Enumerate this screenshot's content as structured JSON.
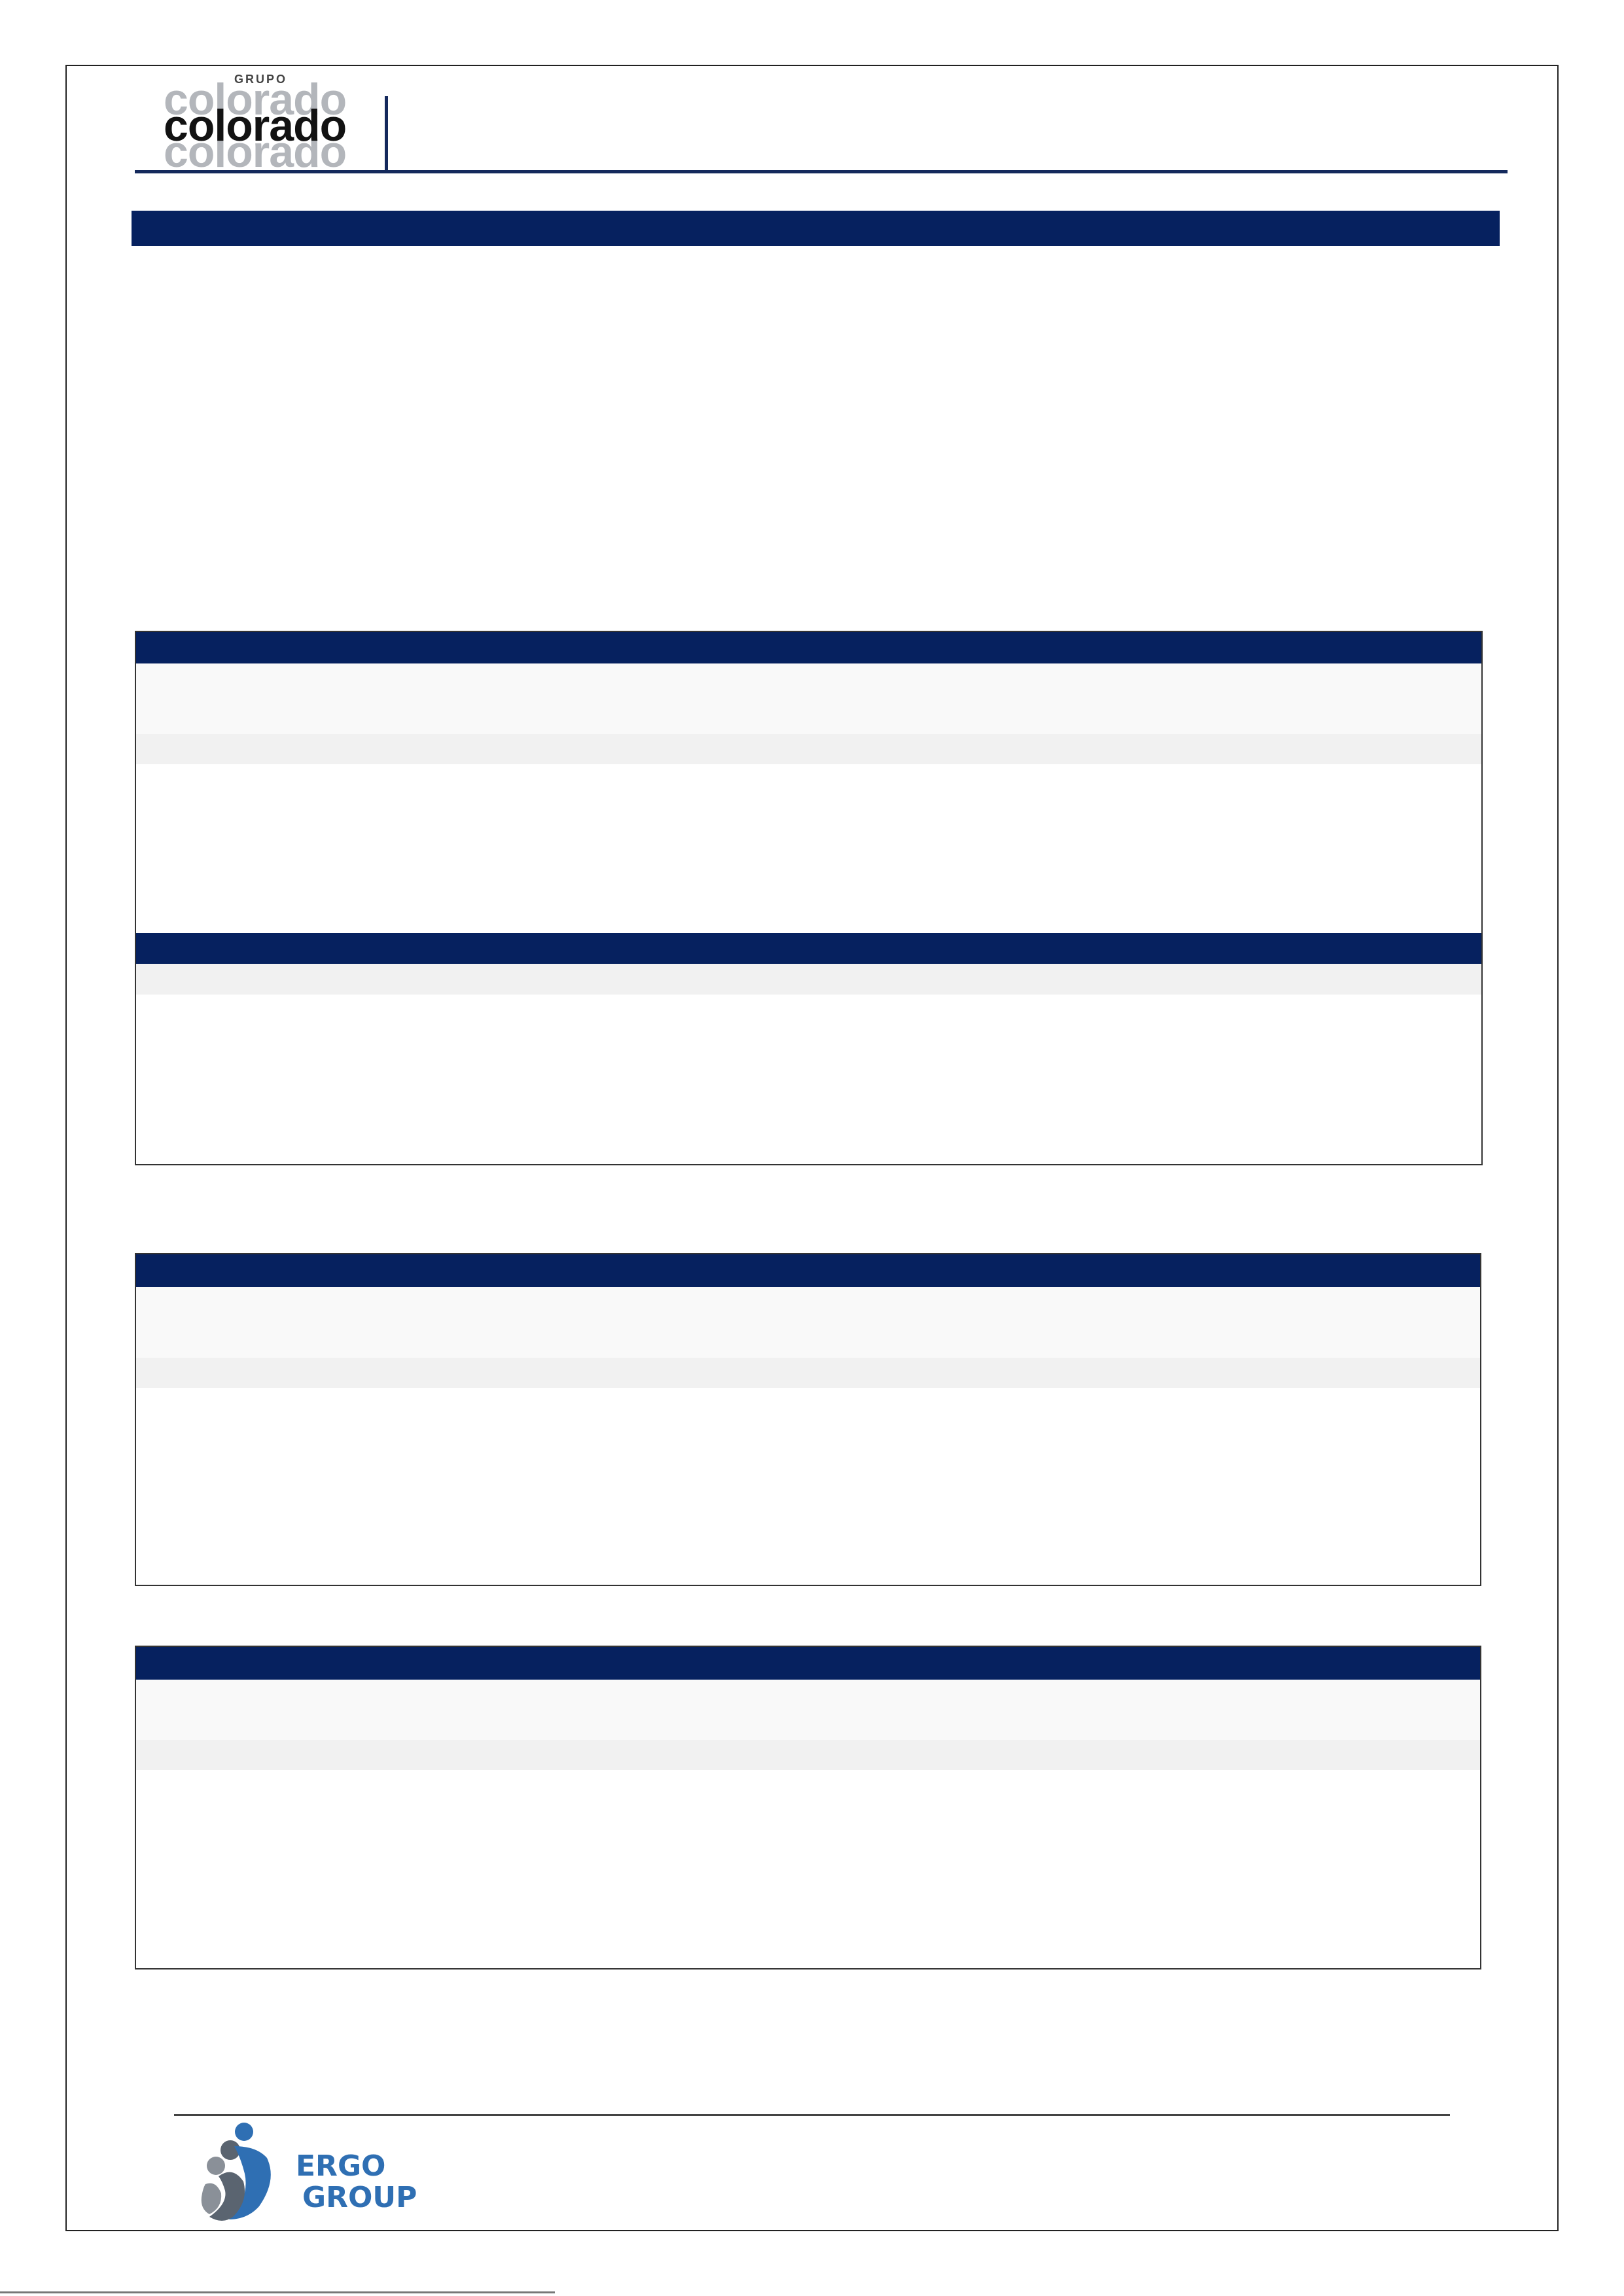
{
  "header": {
    "logo": {
      "small_word": "GRUPO",
      "word": "colorado"
    }
  },
  "footer": {
    "logo": {
      "line1": "ERGO",
      "line2": "GROUP"
    }
  },
  "colors": {
    "navy": "#06215f",
    "rule": "#14295c",
    "logo_gray": "#b3b6bb",
    "ergo_blue": "#2f6fb3"
  }
}
